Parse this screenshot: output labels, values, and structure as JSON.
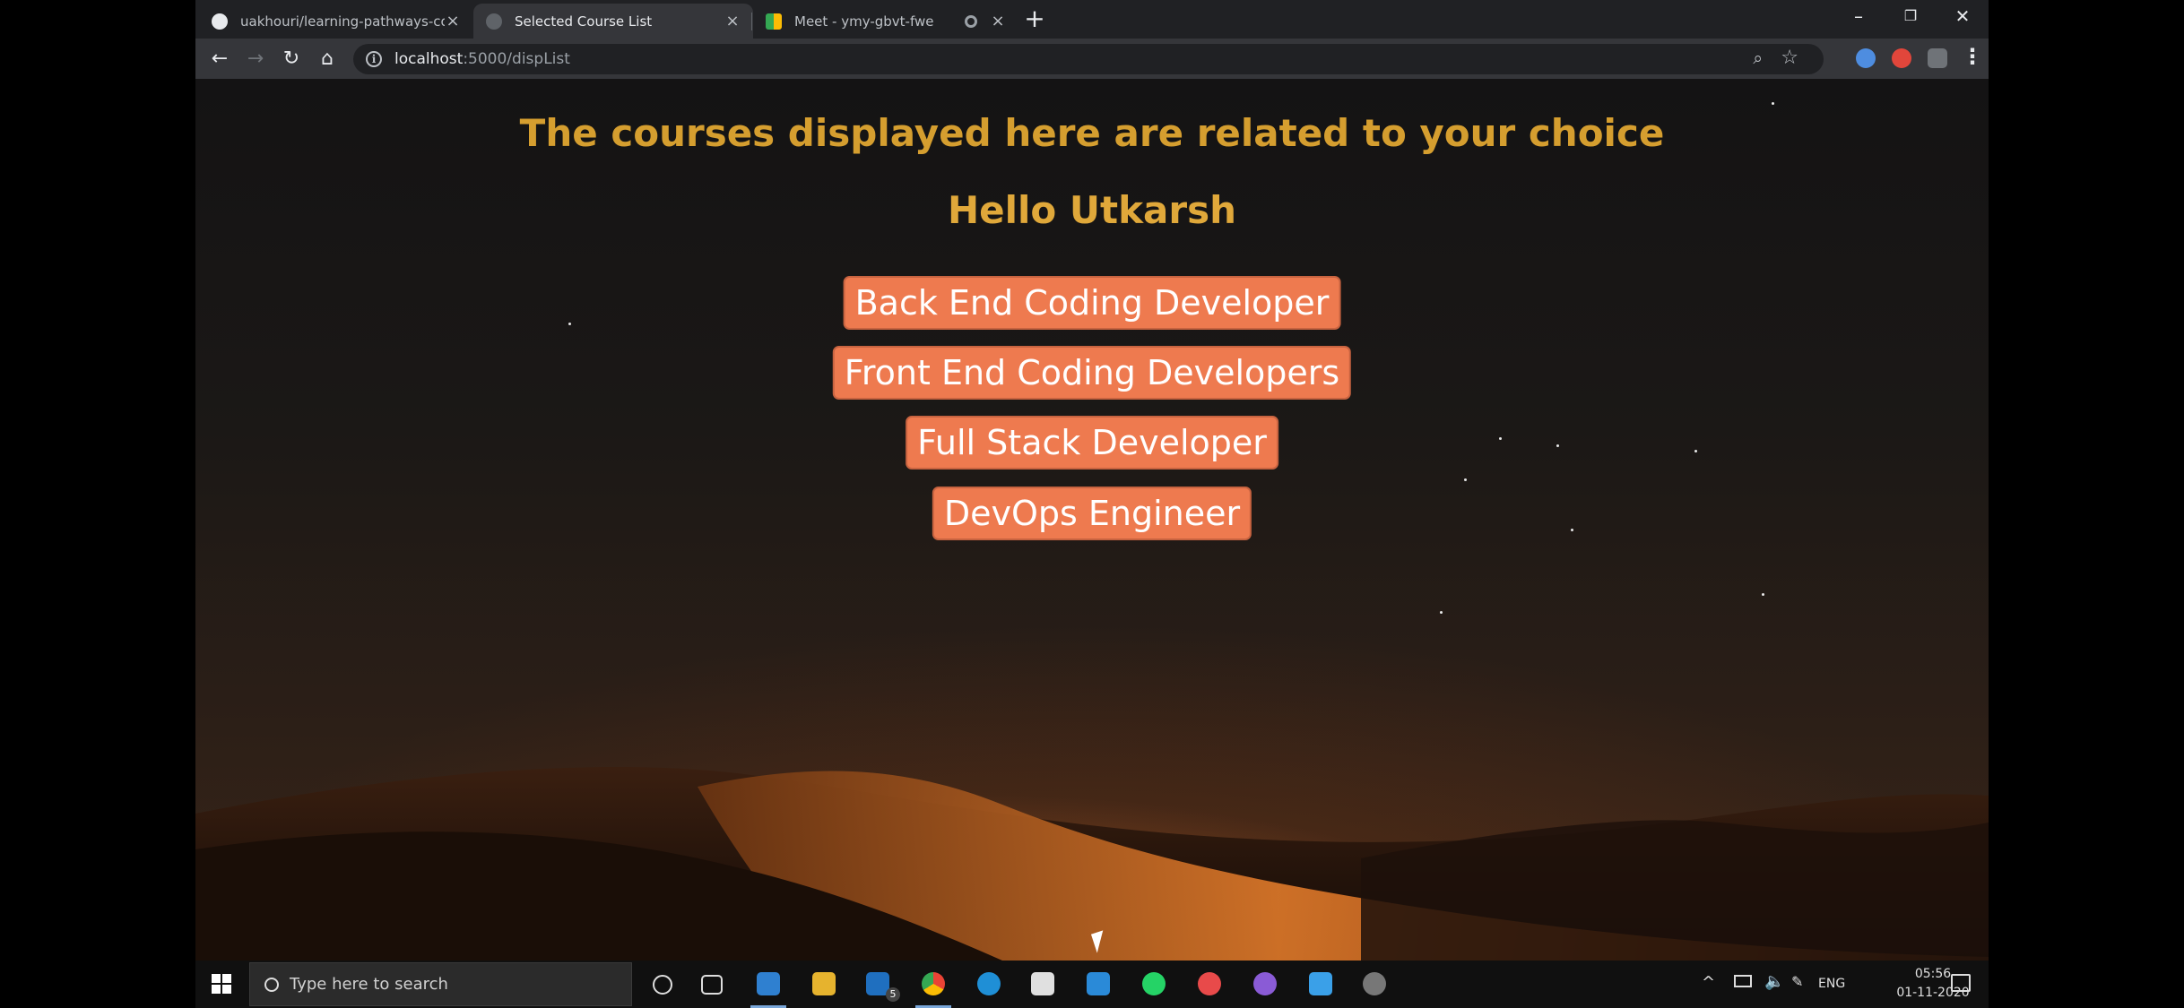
{
  "browser": {
    "tabs": [
      {
        "label": "uakhouri/learning-pathways-coo",
        "favicon": "github-icon",
        "active": false
      },
      {
        "label": "Selected Course List",
        "favicon": "globe-icon",
        "active": true
      },
      {
        "label": "Meet - ymy-gbvt-fwe",
        "favicon": "meet-icon",
        "active": false
      }
    ],
    "address": {
      "host": "localhost",
      "path": ":5000/dispList"
    }
  },
  "page": {
    "heading": "The courses displayed here are related to your choice",
    "greeting": "Hello Utkarsh",
    "courses": [
      "Back End Coding Developer",
      "Front End Coding Developers",
      "Full Stack Developer",
      "DevOps Engineer"
    ],
    "colors": {
      "heading": "#d59e2f",
      "button": "#ee7a4f"
    }
  },
  "taskbar": {
    "search_placeholder": "Type here to search",
    "mail_badge": "5",
    "language": "ENG",
    "time": "05:56",
    "date": "01-11-2020"
  }
}
